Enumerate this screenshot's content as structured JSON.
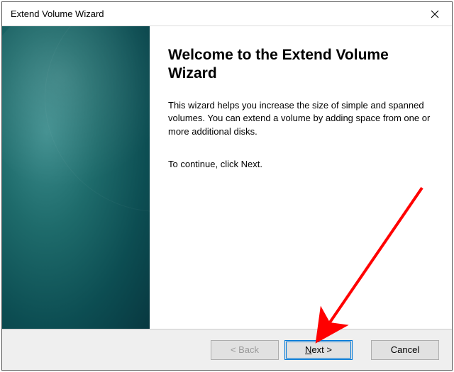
{
  "window": {
    "title": "Extend Volume Wizard"
  },
  "main": {
    "heading": "Welcome to the Extend Volume Wizard",
    "description": "This wizard helps you increase the size of simple and spanned volumes. You can extend a volume  by adding space from one or more additional disks.",
    "continue_hint": "To continue, click Next."
  },
  "buttons": {
    "back": "< Back",
    "next_prefix": "N",
    "next_suffix": "ext >",
    "cancel": "Cancel"
  }
}
